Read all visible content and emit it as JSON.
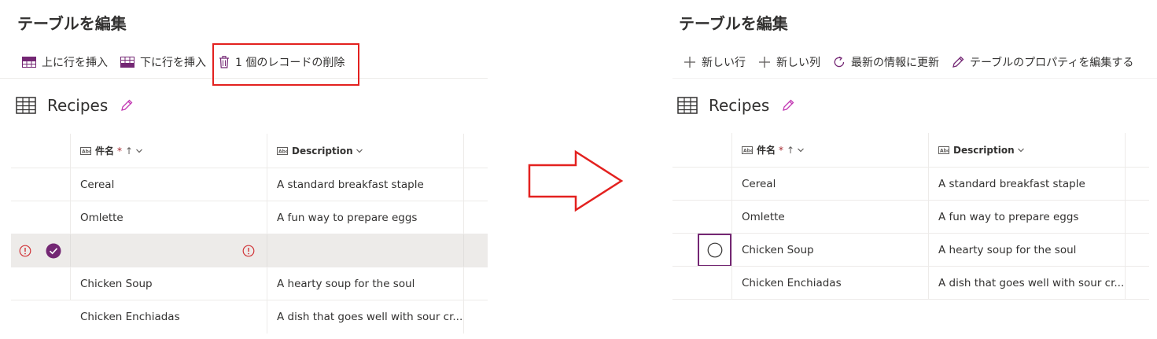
{
  "left": {
    "title": "テーブルを編集",
    "commands": [
      {
        "label": "上に行を挿入",
        "icon": "insert-row-above-icon"
      },
      {
        "label": "下に行を挿入",
        "icon": "insert-row-below-icon"
      },
      {
        "label": "1 個のレコードの削除",
        "icon": "trash-icon"
      }
    ],
    "table_name": "Recipes",
    "columns": {
      "name": "件名",
      "required_mark": "*",
      "sort_mark": "↑",
      "description": "Description"
    },
    "rows": [
      {
        "name": "Cereal",
        "description": "A standard breakfast staple"
      },
      {
        "name": "Omlette",
        "description": "A fun way to prepare eggs"
      },
      {
        "name": "",
        "description": ""
      },
      {
        "name": "Chicken Soup",
        "description": "A hearty soup for the soul"
      },
      {
        "name": "Chicken Enchiadas",
        "description": "A dish that goes well with sour cr..."
      }
    ]
  },
  "right": {
    "title": "テーブルを編集",
    "commands": [
      {
        "label": "新しい行",
        "icon": "plus-icon"
      },
      {
        "label": "新しい列",
        "icon": "plus-icon"
      },
      {
        "label": "最新の情報に更新",
        "icon": "refresh-icon"
      },
      {
        "label": "テーブルのプロパティを編集する",
        "icon": "pencil-icon"
      }
    ],
    "table_name": "Recipes",
    "columns": {
      "name": "件名",
      "required_mark": "*",
      "sort_mark": "↑",
      "description": "Description"
    },
    "rows": [
      {
        "name": "Cereal",
        "description": "A standard breakfast staple"
      },
      {
        "name": "Omlette",
        "description": "A fun way to prepare eggs"
      },
      {
        "name": "Chicken Soup",
        "description": "A hearty soup for the soul"
      },
      {
        "name": "Chicken Enchiadas",
        "description": "A dish that goes well with sour cr..."
      }
    ]
  },
  "colors": {
    "accent": "#742774",
    "highlight": "#e3211f",
    "error": "#d13438",
    "edit_pencil": "#c239b3"
  }
}
